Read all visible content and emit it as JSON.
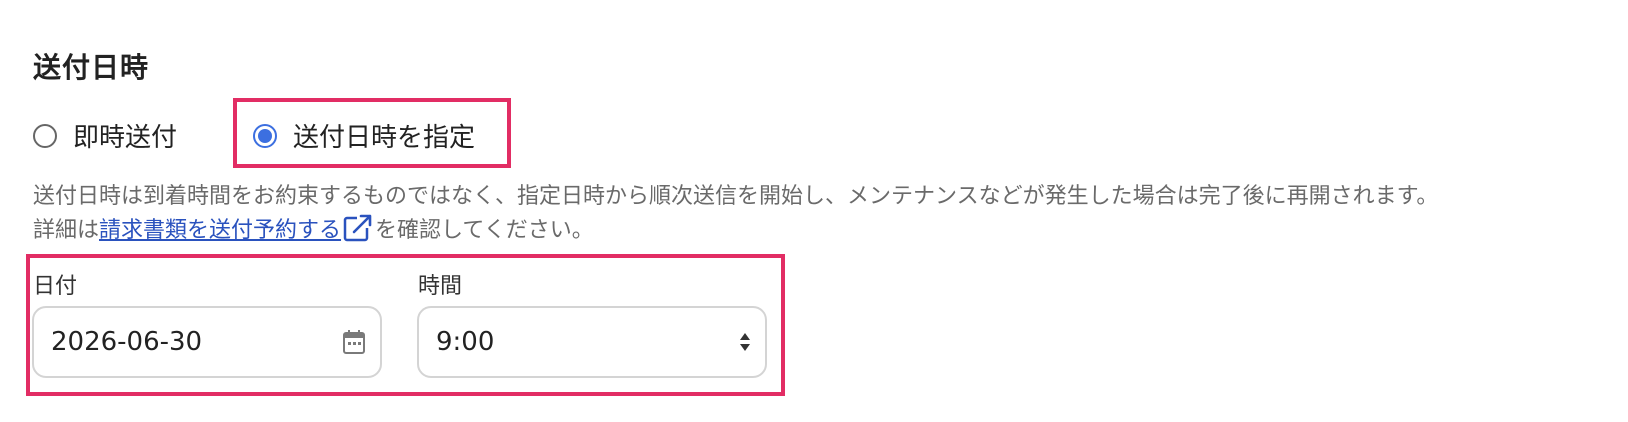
{
  "section": {
    "title": "送付日時"
  },
  "radio": {
    "immediate": {
      "label": "即時送付",
      "selected": false
    },
    "scheduled": {
      "label": "送付日時を指定",
      "selected": true
    },
    "accent_color": "#3c6fe0"
  },
  "help": {
    "line1": "送付日時は到着時間をお約束するものではなく、指定日時から順次送信を開始し、メンテナンスなどが発生した場合は完了後に再開されます。",
    "line2_prefix": "詳細は",
    "link_text": "請求書類を送付予約する",
    "line2_suffix": "を確認してください。",
    "link_icon": "external-link-icon"
  },
  "fields": {
    "date": {
      "label": "日付",
      "value": "2026-06-30",
      "icon": "calendar-icon"
    },
    "time": {
      "label": "時間",
      "value": "9:00",
      "icon": "select-arrows-icon"
    }
  },
  "highlight_color": "#e22d64"
}
